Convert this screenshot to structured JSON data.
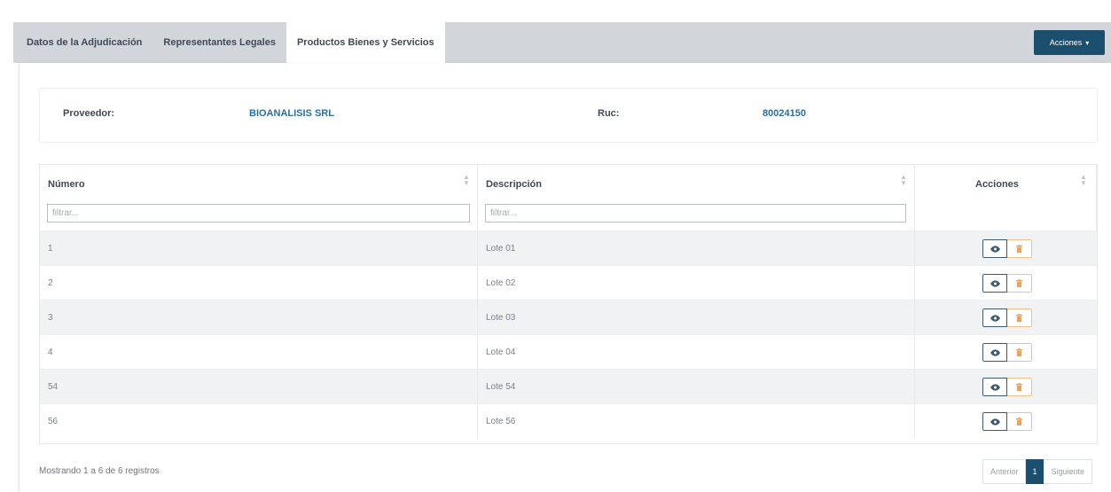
{
  "tabs": [
    {
      "label": "Datos de la Adjudicación"
    },
    {
      "label": "Representantes Legales"
    },
    {
      "label": "Productos Bienes y Servicios"
    }
  ],
  "actions_button": {
    "label": "Acciones",
    "caret": "▾"
  },
  "provider": {
    "label": "Proveedor:",
    "value": "BIOANALISIS SRL",
    "ruc_label": "Ruc:",
    "ruc_value": "80024150"
  },
  "table": {
    "columns": [
      {
        "label": "Número",
        "filter_placeholder": "filtrar..."
      },
      {
        "label": "Descripción",
        "filter_placeholder": "filtrar..."
      },
      {
        "label": "Acciones"
      }
    ],
    "rows": [
      {
        "numero": "1",
        "descripcion": "Lote 01"
      },
      {
        "numero": "2",
        "descripcion": "Lote 02"
      },
      {
        "numero": "3",
        "descripcion": "Lote 03"
      },
      {
        "numero": "4",
        "descripcion": "Lote 04"
      },
      {
        "numero": "54",
        "descripcion": "Lote 54"
      },
      {
        "numero": "56",
        "descripcion": "Lote 56"
      }
    ]
  },
  "footer": {
    "info": "Mostrando 1 a 6 de 6 registros",
    "prev": "Anterior",
    "page": "1",
    "next": "Siguiente"
  },
  "colors": {
    "primary": "#1c4e6e",
    "link": "#2a6ea0",
    "delete": "#e8a35c"
  },
  "icons": {
    "view": "eye-icon",
    "delete": "trash-icon",
    "sort": "sort-icon"
  }
}
